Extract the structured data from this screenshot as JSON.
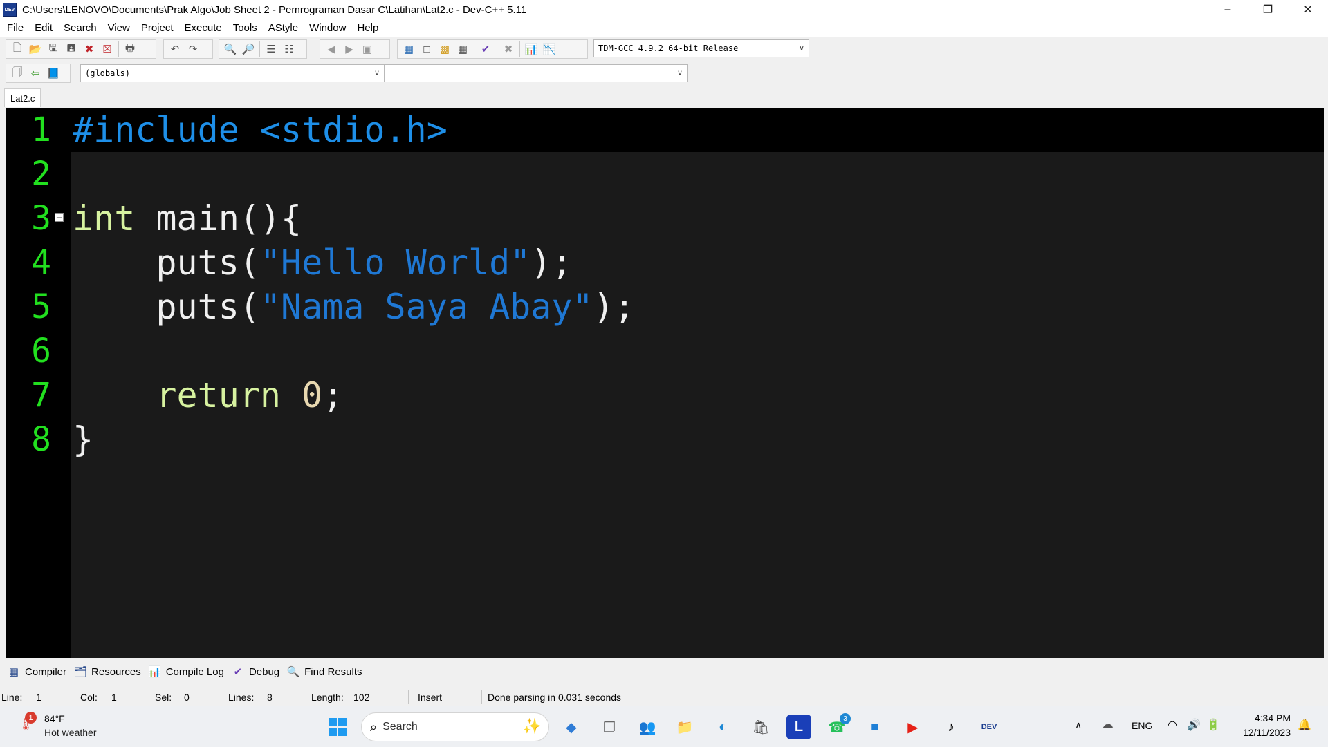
{
  "window": {
    "title": "C:\\Users\\LENOVO\\Documents\\Prak Algo\\Job Sheet 2 - Pemrograman Dasar C\\Latihan\\Lat2.c - Dev-C++ 5.11",
    "app_icon_label": "DEV"
  },
  "menu": [
    "File",
    "Edit",
    "Search",
    "View",
    "Project",
    "Execute",
    "Tools",
    "AStyle",
    "Window",
    "Help"
  ],
  "toolbar": {
    "compiler_select": "TDM-GCC 4.9.2 64-bit Release",
    "scope_select": "(globals)",
    "function_select": ""
  },
  "file_tab": "Lat2.c",
  "editor": {
    "line_numbers": [
      "1",
      "2",
      "3",
      "4",
      "5",
      "6",
      "7",
      "8"
    ],
    "colors": {
      "background": "#1a1a1a",
      "gutter": "#000000",
      "line_number": "#22e01f",
      "preprocessor": "#1e8fe8",
      "keyword": "#d7f2a0",
      "string": "#1f78d4",
      "number": "#e8d8b0",
      "text": "#f0f0f0"
    },
    "code": {
      "l1_pre": "#include <stdio.h>",
      "l3_kw": "int",
      "l3_rest": " main(){",
      "l4_a": "    puts(",
      "l4_str": "\"Hello World\"",
      "l4_b": ");",
      "l5_a": "    puts(",
      "l5_str": "\"Nama Saya Abay\"",
      "l5_b": ");",
      "l7_kw": "    return",
      "l7_num": "0",
      "l7_end": ";",
      "l8": "}"
    }
  },
  "panel_tabs": [
    "Compiler",
    "Resources",
    "Compile Log",
    "Debug",
    "Find Results"
  ],
  "status": {
    "line_label": "Line:",
    "line_value": "1",
    "col_label": "Col:",
    "col_value": "1",
    "sel_label": "Sel:",
    "sel_value": "0",
    "lines_label": "Lines:",
    "lines_value": "8",
    "length_label": "Length:",
    "length_value": "102",
    "mode": "Insert",
    "message": "Done parsing in 0.031 seconds"
  },
  "taskbar": {
    "weather_temp": "84°F",
    "weather_desc": "Hot weather",
    "weather_badge": "1",
    "search_label": "Search",
    "whatsapp_badge": "3",
    "language": "ENG",
    "time": "4:34 PM",
    "date": "12/11/2023"
  }
}
